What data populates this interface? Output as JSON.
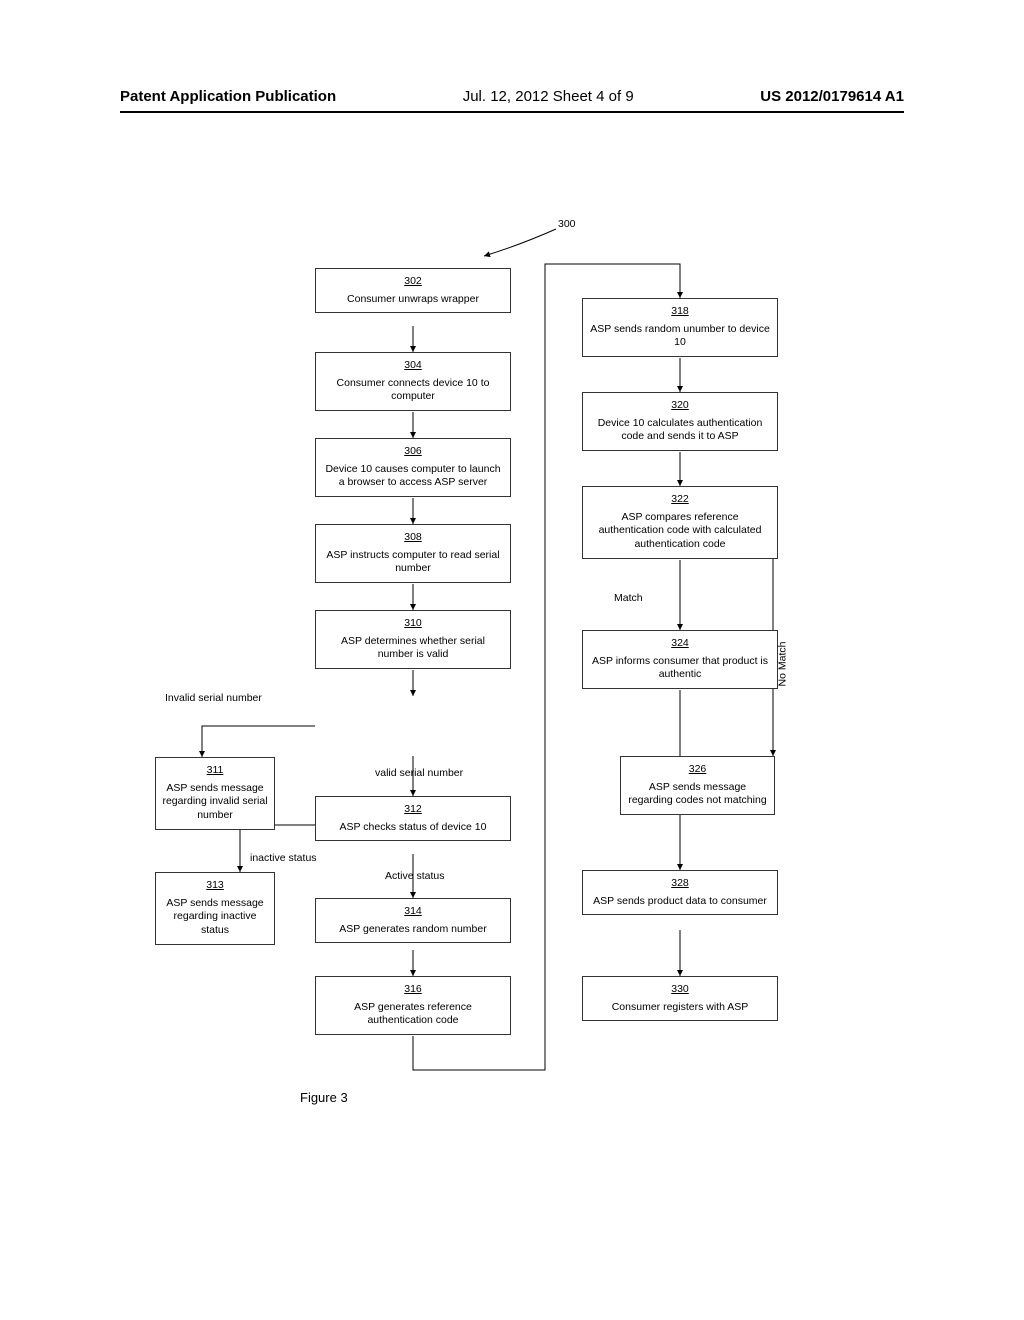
{
  "header": {
    "left": "Patent Application Publication",
    "mid": "Jul. 12, 2012  Sheet 4 of 9",
    "right": "US 2012/0179614 A1"
  },
  "ref300": "300",
  "figure_label": "Figure 3",
  "boxes": {
    "b302": {
      "num": "302",
      "text": "Consumer unwraps wrapper"
    },
    "b304": {
      "num": "304",
      "text": "Consumer connects device 10 to computer"
    },
    "b306": {
      "num": "306",
      "text": "Device 10 causes computer to launch a browser to access ASP server"
    },
    "b308": {
      "num": "308",
      "text": "ASP instructs computer to read serial number"
    },
    "b310": {
      "num": "310",
      "text": "ASP determines whether serial number is valid"
    },
    "b311": {
      "num": "311",
      "text": "ASP sends message regarding invalid serial number"
    },
    "b312": {
      "num": "312",
      "text": "ASP checks status of device 10"
    },
    "b313": {
      "num": "313",
      "text": "ASP sends message regarding inactive status"
    },
    "b314": {
      "num": "314",
      "text": "ASP generates random number"
    },
    "b316": {
      "num": "316",
      "text": "ASP generates reference authentication code"
    },
    "b318": {
      "num": "318",
      "text": "ASP sends random unumber to device 10"
    },
    "b320": {
      "num": "320",
      "text": "Device 10 calculates authentication code and sends it to ASP"
    },
    "b322": {
      "num": "322",
      "text": "ASP compares reference authentication code with calculated authentication code"
    },
    "b324": {
      "num": "324",
      "text": "ASP informs consumer that product is authentic"
    },
    "b326": {
      "num": "326",
      "text": "ASP sends message regarding codes not matching"
    },
    "b328": {
      "num": "328",
      "text": "ASP sends product data to consumer"
    },
    "b330": {
      "num": "330",
      "text": "Consumer registers with ASP"
    }
  },
  "labels": {
    "invalid_serial": "Invalid serial number",
    "valid_serial": "valid serial number",
    "inactive": "inactive status",
    "active": "Active status",
    "match": "Match",
    "nomatch": "No Match"
  }
}
